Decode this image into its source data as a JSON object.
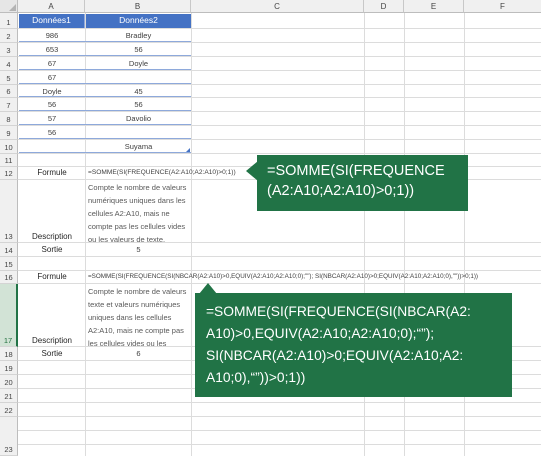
{
  "columns": [
    "A",
    "B",
    "C",
    "D",
    "E",
    "F"
  ],
  "rows": [
    "1",
    "2",
    "3",
    "4",
    "5",
    "6",
    "7",
    "8",
    "9",
    "10",
    "11",
    "12",
    "13",
    "14",
    "15",
    "16",
    "17",
    "18",
    "19",
    "20",
    "21",
    "22",
    "23"
  ],
  "table": {
    "headers": [
      "Données1",
      "Données2"
    ],
    "data": [
      [
        "986",
        "Bradley"
      ],
      [
        "653",
        "56"
      ],
      [
        "67",
        "Doyle"
      ],
      [
        "67",
        ""
      ],
      [
        "Doyle",
        "45"
      ],
      [
        "56",
        "56"
      ],
      [
        "57",
        "Davolio"
      ],
      [
        "56",
        ""
      ],
      [
        "",
        "Suyama"
      ]
    ]
  },
  "example1": {
    "formula_label": "Formule",
    "formula_text": "=SOMME(SI(FREQUENCE(A2:A10;A2:A10)>0;1))",
    "description_label": "Description",
    "description_text": "Compte le nombre de valeurs numériques uniques dans les cellules A2:A10, mais ne compte pas les cellules vides ou les valeurs de texte.",
    "output_label": "Sortie",
    "output_value": "5"
  },
  "example2": {
    "formula_label": "Formule",
    "formula_text": "=SOMME(SI(FREQUENCE(SI(NBCAR(A2:A10)>0,EQUIV(A2:A10;A2:A10;0);\"\"); SI(NBCAR(A2:A10)>0;EQUIV(A2:A10;A2:A10;0),\"\"))>0;1))",
    "description_label": "Description",
    "description_text": "Compte le nombre de valeurs texte et valeurs numériques uniques dans les cellules A2:A10, mais ne compte pas les cellules vides ou les",
    "output_label": "Sortie",
    "output_value": "6"
  },
  "callout1": {
    "line1": "=SOMME(SI(FREQUENCE",
    "line2": "(A2:A10;A2:A10)>0;1))"
  },
  "callout2": {
    "line1": "=SOMME(SI(FREQUENCE(SI(NBCAR(A2:",
    "line2": "A10)>0,EQUIV(A2:A10;A2:A10;0);“”);",
    "line3": "SI(NBCAR(A2:A10)>0;EQUIV(A2:A10;A2:",
    "line4": "A10;0),“”))>0;1))"
  },
  "colors": {
    "table_header": "#4472c4",
    "callout": "#217346",
    "selected_row": "#d2e3d6"
  },
  "icons": {
    "corner": "select-all-triangle",
    "table_resize": "table-resize-handle"
  }
}
